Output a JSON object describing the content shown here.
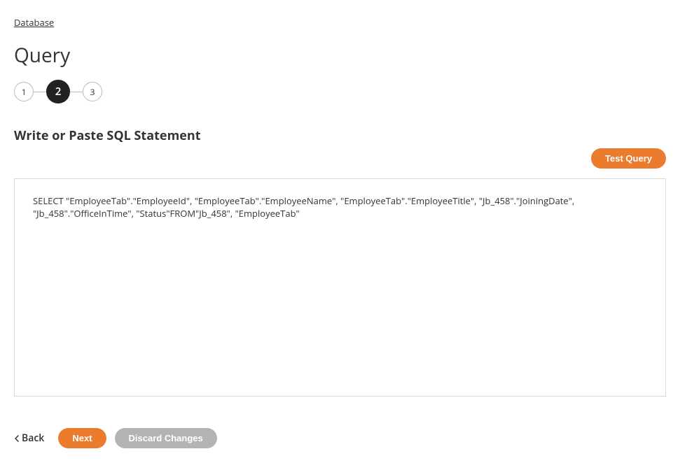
{
  "breadcrumb": {
    "label": "Database"
  },
  "page": {
    "title": "Query"
  },
  "stepper": {
    "steps": [
      "1",
      "2",
      "3"
    ],
    "active_index": 1
  },
  "section": {
    "heading": "Write or Paste SQL Statement",
    "test_button": "Test Query",
    "sql_value": "SELECT \"EmployeeTab\".\"EmployeeId\", \"EmployeeTab\".\"EmployeeName\", \"EmployeeTab\".\"EmployeeTitle\", \"Jb_458\".\"JoiningDate\", \"Jb_458\".\"OfficeInTime\", \"Status\"FROM\"Jb_458\", \"EmployeeTab\""
  },
  "footer": {
    "back": "Back",
    "next": "Next",
    "discard": "Discard Changes"
  }
}
